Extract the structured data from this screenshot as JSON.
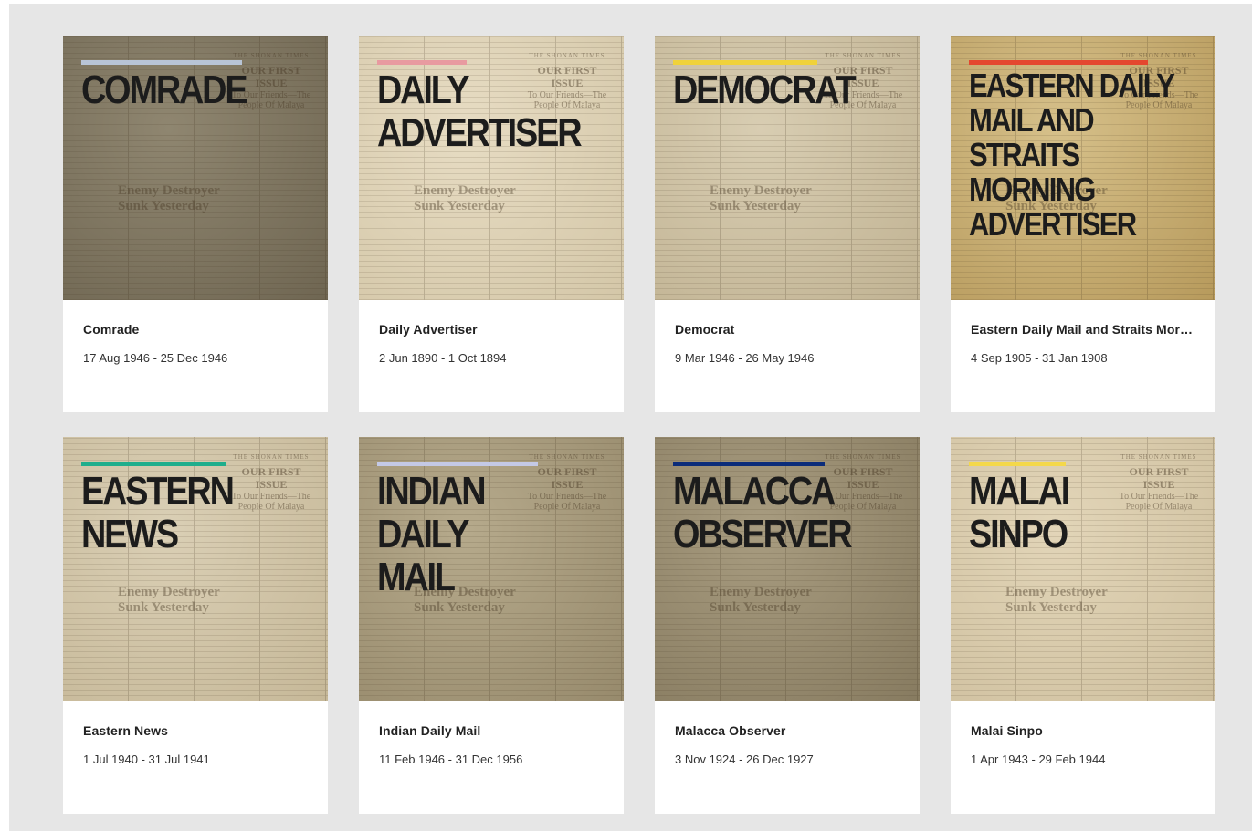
{
  "colors": {
    "panel_bg": "#e6e6e6",
    "card_bg": "#ffffff",
    "title_text": "#1c1c1c"
  },
  "newspaper_texture": {
    "masthead_small": "THE SHONAN TIMES",
    "masthead_first_issue": "OUR FIRST ISSUE",
    "masthead_friends": "To Our Friends—The People Of Malaya",
    "headline_line1": "Enemy Destroyer",
    "headline_line2": "Sunk Yesterday"
  },
  "cards": [
    {
      "cover_lines": [
        "COMRADE"
      ],
      "accent_color": "#b8c4d6",
      "accent_width": 176,
      "bg_a": "#8f8670",
      "bg_b": "#6f6652",
      "title": "Comrade",
      "dates": "17 Aug 1946 - 25 Dec 1946"
    },
    {
      "cover_lines": [
        "DAILY",
        "ADVERTISER"
      ],
      "accent_color": "#e89aa0",
      "accent_width": 98,
      "bg_a": "#e7dcc3",
      "bg_b": "#d4c7a8",
      "title": "Daily Advertiser",
      "dates": "2 Jun 1890 - 1 Oct 1894"
    },
    {
      "cover_lines": [
        "DEMOCRAT"
      ],
      "accent_color": "#f0d23a",
      "accent_width": 158,
      "bg_a": "#d8cdb2",
      "bg_b": "#c1b393",
      "title": "Democrat",
      "dates": "9 Mar 1946 - 26 May 1946"
    },
    {
      "cover_lines": [
        "EASTERN DAILY",
        "MAIL AND",
        "STRAITS",
        "MORNING",
        "ADVERTISER"
      ],
      "accent_color": "#e4472f",
      "accent_width": 196,
      "bg_a": "#d6c08a",
      "bg_b": "#b79a5c",
      "title": "Eastern Daily Mail and Straits Morning Advertiser",
      "dates": "4 Sep 1905 - 31 Jan 1908",
      "small": true
    },
    {
      "cover_lines": [
        "EASTERN",
        "NEWS"
      ],
      "accent_color": "#1fae8c",
      "accent_width": 158,
      "bg_a": "#dacfb5",
      "bg_b": "#c6b898",
      "title": "Eastern News",
      "dates": "1 Jul 1940 - 31 Jul 1941"
    },
    {
      "cover_lines": [
        "INDIAN",
        "DAILY",
        "MAIL"
      ],
      "accent_color": "#c4c9e6",
      "accent_width": 176,
      "bg_a": "#b6aa8c",
      "bg_b": "#978a6c",
      "title": "Indian Daily Mail",
      "dates": "11 Feb 1946 - 31 Dec 1956"
    },
    {
      "cover_lines": [
        "MALACCA",
        "OBSERVER"
      ],
      "accent_color": "#0b2c7a",
      "accent_width": 166,
      "bg_a": "#a89c80",
      "bg_b": "#877b60",
      "title": "Malacca Observer",
      "dates": "3 Nov 1924 - 26 Dec 1927"
    },
    {
      "cover_lines": [
        "MALAI",
        "SINPO"
      ],
      "accent_color": "#f4d84a",
      "accent_width": 106,
      "bg_a": "#e2d5b8",
      "bg_b": "#cfc09f",
      "title": "Malai Sinpo",
      "dates": "1 Apr 1943 - 29 Feb 1944"
    }
  ]
}
